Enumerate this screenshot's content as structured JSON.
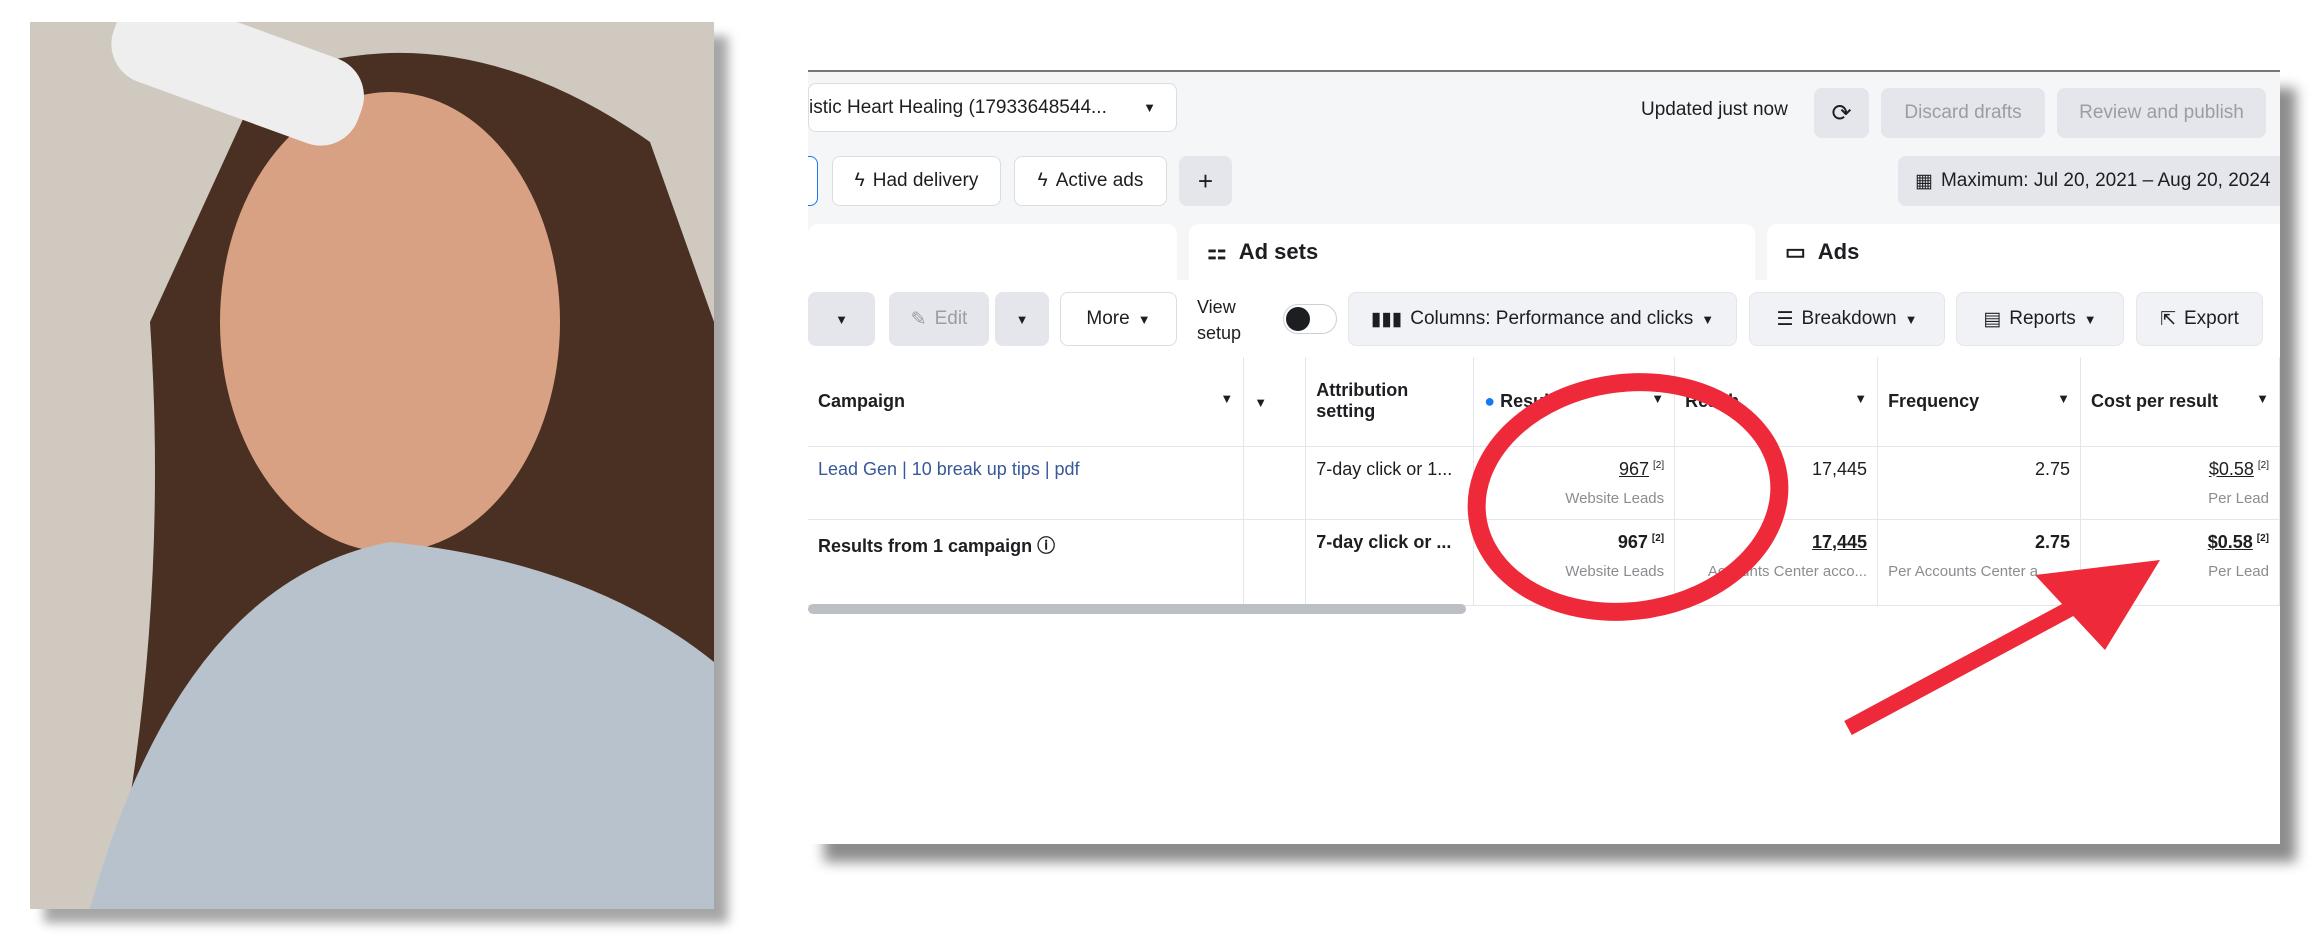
{
  "header": {
    "account": "istic Heart Healing (17933648544...",
    "updated": "Updated just now",
    "discard": "Discard drafts",
    "review": "Review and publish"
  },
  "filters": {
    "had_delivery": "Had delivery",
    "active_ads": "Active ads",
    "add": "+",
    "date_range": "Maximum: Jul 20, 2021 – Aug 20, 2024"
  },
  "tabs": {
    "ad_sets": "Ad sets",
    "ads": "Ads"
  },
  "toolbar": {
    "edit": "Edit",
    "more": "More",
    "view_setup": "View setup",
    "columns": "Columns: Performance and clicks",
    "breakdown": "Breakdown",
    "reports": "Reports",
    "export": "Export"
  },
  "table": {
    "headers": {
      "campaign": "Campaign",
      "attribution": "Attribution setting",
      "results": "Results",
      "reach": "Reach",
      "frequency": "Frequency",
      "cost": "Cost per result"
    },
    "rows": [
      {
        "campaign": "Lead Gen | 10 break up tips | pdf",
        "attribution": "7-day click or 1...",
        "results": "967",
        "results_sub": "Website Leads",
        "reach": "17,445",
        "reach_sub": "",
        "frequency": "2.75",
        "frequency_sub": "",
        "cost": "$0.58",
        "cost_sub": "Per Lead"
      },
      {
        "campaign": "Results from 1 campaign",
        "attribution": "7-day click or ...",
        "results": "967",
        "results_sub": "Website Leads",
        "reach": "17,445",
        "reach_sub": "Accounts Center acco...",
        "frequency": "2.75",
        "frequency_sub": "Per Accounts Center a...",
        "cost": "$0.58",
        "cost_sub": "Per Lead"
      }
    ],
    "footnote": "[2]"
  },
  "annotation_color": "#ee2a3a"
}
